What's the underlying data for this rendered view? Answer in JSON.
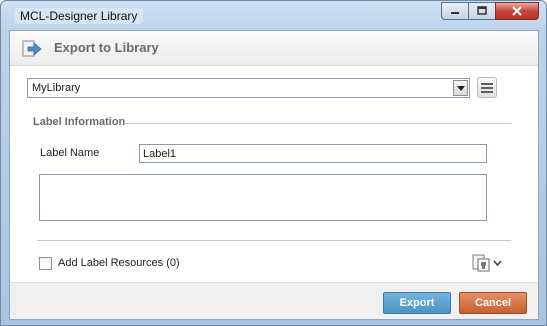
{
  "window": {
    "title": "MCL-Designer Library",
    "controls": [
      "minimize-icon",
      "maximize-icon",
      "close-icon"
    ]
  },
  "header": {
    "title": "Export to Library",
    "icon": "export-arrow-icon"
  },
  "library_select": {
    "value": "MyLibrary",
    "menu_icon": "hamburger-menu-icon"
  },
  "label_information": {
    "group_title": "Label Information",
    "label_name_caption": "Label Name",
    "label_name_value": "Label1",
    "description_value": ""
  },
  "resources": {
    "checkbox_label": "Add Label Resources (0)",
    "checked": false,
    "icon": "resources-dropdown-icon"
  },
  "footer": {
    "export_label": "Export",
    "cancel_label": "Cancel"
  },
  "colors": {
    "export_button": "#4a92c4",
    "cancel_button": "#c8602e",
    "close_button": "#c8453a"
  }
}
